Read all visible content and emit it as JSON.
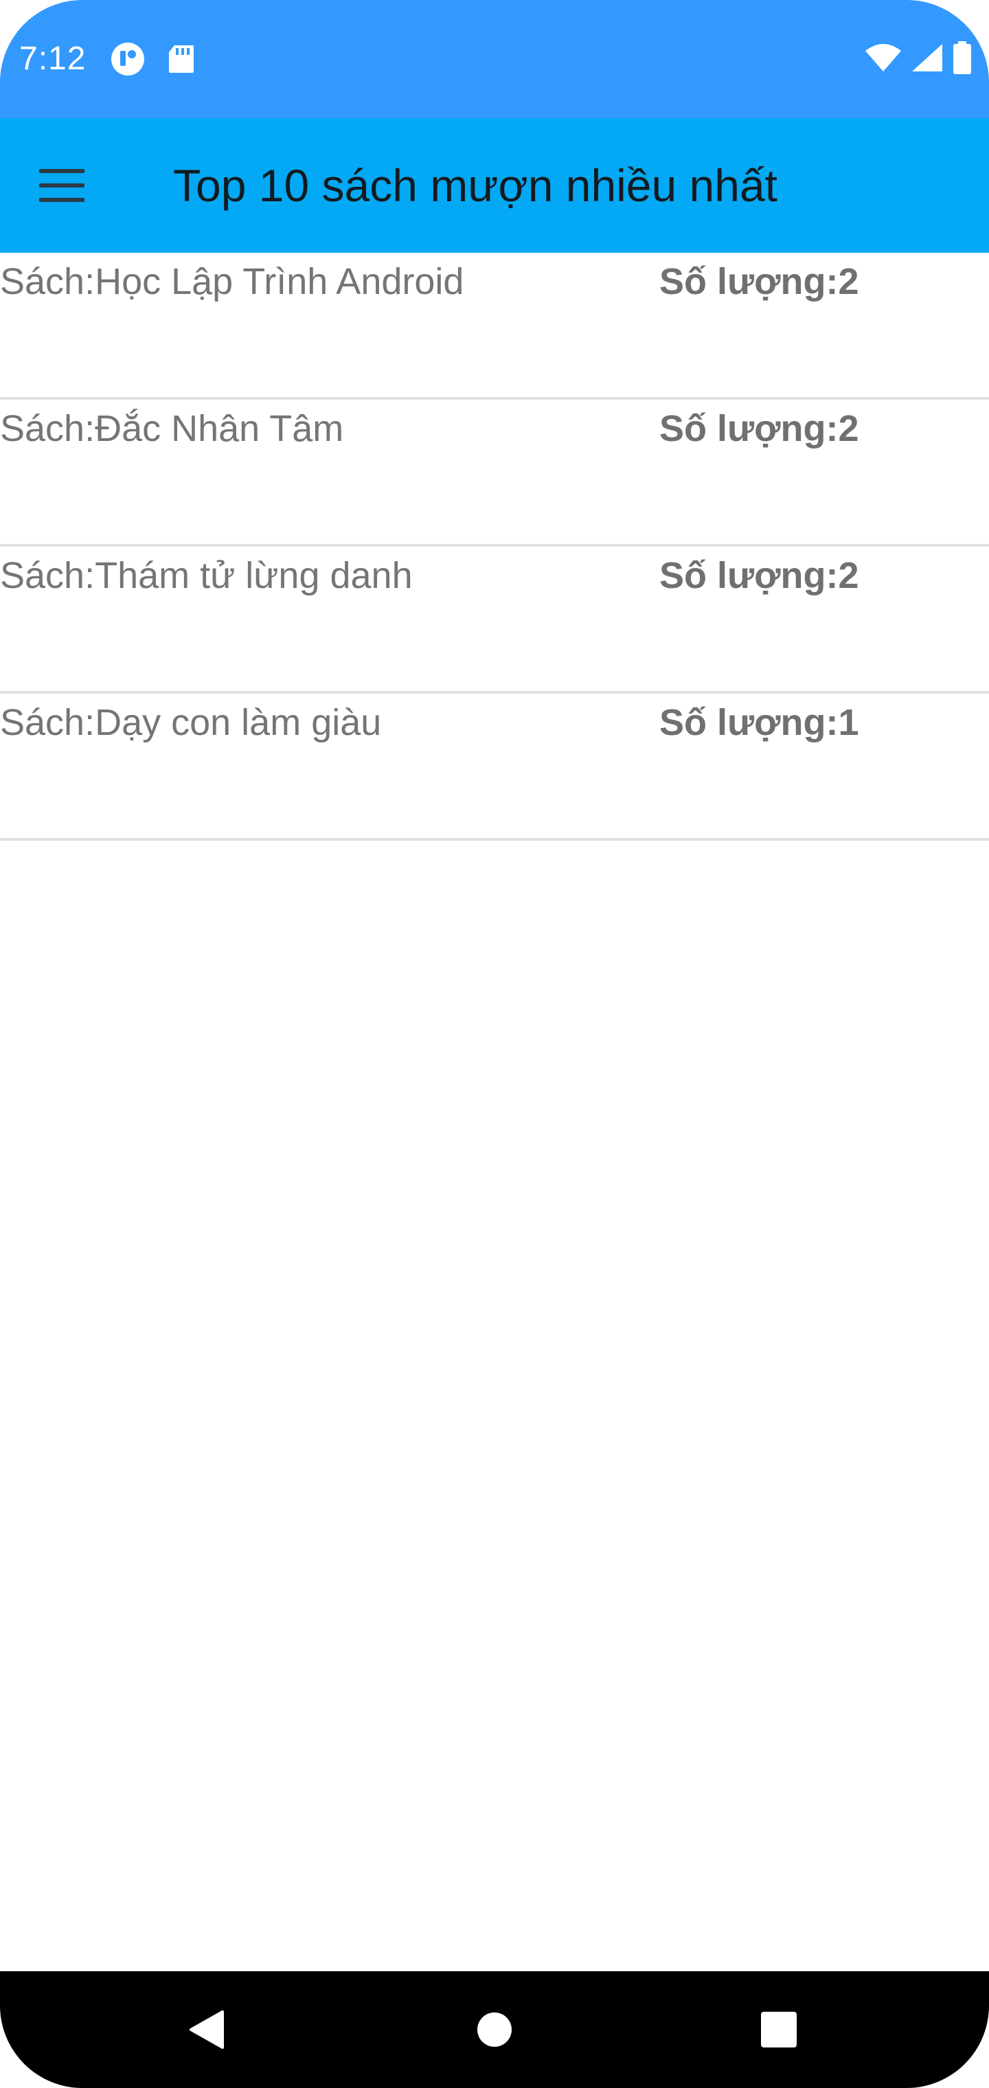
{
  "status_bar": {
    "time": "7:12",
    "background": "#3399ff",
    "icons_left": [
      "notification-app-icon",
      "sd-card-icon"
    ],
    "icons_right": [
      "wifi-icon",
      "cell-signal-icon",
      "battery-icon"
    ]
  },
  "app_bar": {
    "title": "Top 10 sách mượn nhiều nhất",
    "background": "#03a9f4",
    "menu_icon": "hamburger-menu-icon"
  },
  "books": [
    {
      "name": "Sách:Học Lập Trình Android",
      "quantity": "Số lượng:2"
    },
    {
      "name": "Sách:Đắc Nhân Tâm",
      "quantity": "Số lượng:2"
    },
    {
      "name": "Sách:Thám tử lừng danh",
      "quantity": "Số lượng:2"
    },
    {
      "name": "Sách:Dạy con làm giàu",
      "quantity": "Số lượng:1"
    }
  ],
  "nav_bar": {
    "buttons": [
      "back-icon",
      "home-icon",
      "recents-icon"
    ]
  }
}
